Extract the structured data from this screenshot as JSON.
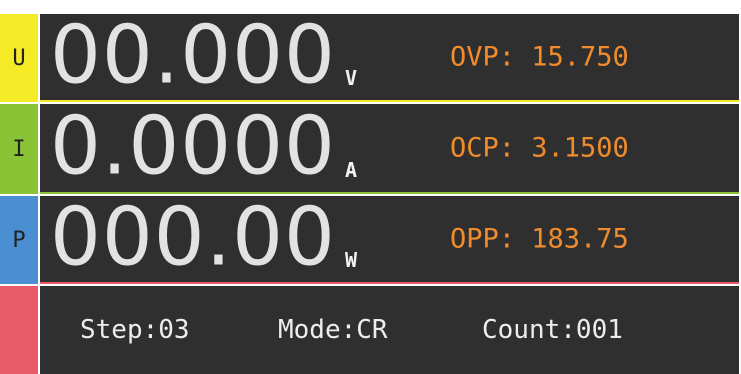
{
  "rows": [
    {
      "label": "U",
      "value": "00.000",
      "unit": "V",
      "protection": "OVP: 15.750",
      "color": "#f4ea26",
      "line": "#f4ea26"
    },
    {
      "label": "I",
      "value": "0.0000",
      "unit": "A",
      "protection": "OCP: 3.1500",
      "color": "#8ac436",
      "line": "#8ac436"
    },
    {
      "label": "P",
      "value": "000.00",
      "unit": "W",
      "protection": "OPP: 183.75",
      "color": "#4a8fd2",
      "line": "#ea5b6a"
    }
  ],
  "status": {
    "color": "#ea5b6a",
    "step": "Step:03",
    "mode": "Mode:CR",
    "count": "Count:001"
  }
}
